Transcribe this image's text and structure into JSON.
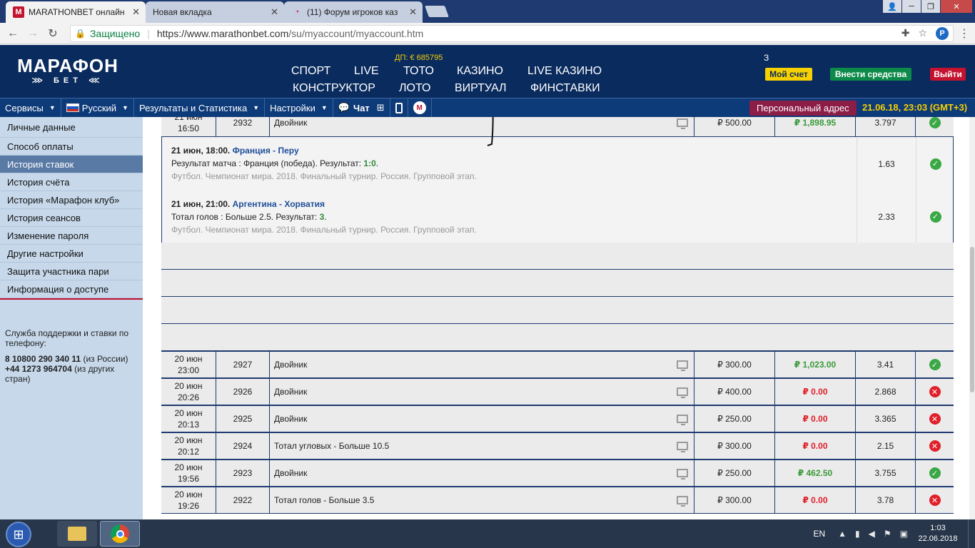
{
  "browser": {
    "tabs": [
      {
        "title": "MARATHONBET онлайн",
        "favicon": "marathon-favicon",
        "active": true
      },
      {
        "title": "Новая вкладка",
        "favicon": "blank",
        "active": false
      },
      {
        "title": "(11) Форум игроков каз",
        "favicon": "chat-favicon",
        "active": false
      }
    ],
    "secure_label": "Защищено",
    "url_host": "https://www.marathonbet.com",
    "url_path": "/su/myaccount/myaccount.htm"
  },
  "header": {
    "logo_main": "МАРАФОН",
    "logo_sub": "БЕТ",
    "jackpot": "ДП: € 685795",
    "nav": {
      "sport": "СПОРТ",
      "live": "LIVE",
      "toto": "ТОТО",
      "casino": "КАЗИНО",
      "live_casino": "LIVE КАЗИНО",
      "constructor": "КОНСТРУКТОР",
      "loto": "ЛОТО",
      "virtual": "ВИРТУАЛ",
      "finstavki": "ФИНСТАВКИ"
    },
    "account_name": "З",
    "my_account": "Мой счет",
    "deposit": "Внести средства",
    "logout": "Выйти"
  },
  "subnav": {
    "services": "Сервисы",
    "language": "Русский",
    "results": "Результаты и Статистика",
    "settings": "Настройки",
    "chat": "Чат",
    "personal_address": "Персональный адрес",
    "datetime": "21.06.18, 23:03 (GMT+3)"
  },
  "sidebar": {
    "items": [
      {
        "label": "Личные данные",
        "active": false
      },
      {
        "label": "Способ оплаты",
        "active": false
      },
      {
        "label": "История ставок",
        "active": true
      },
      {
        "label": "История счёта",
        "active": false
      },
      {
        "label": "История «Марафон клуб»",
        "active": false
      },
      {
        "label": "История сеансов",
        "active": false
      },
      {
        "label": "Изменение пароля",
        "active": false
      },
      {
        "label": "Другие настройки",
        "active": false
      },
      {
        "label": "Защита участника пари",
        "active": false
      },
      {
        "label": "Информация о доступе",
        "active": false
      }
    ],
    "support_title": "Служба поддержки и ставки по телефону:",
    "phone_ru": "8 10800 290 340 11",
    "phone_ru_note": "(из России)",
    "phone_intl": "+44 1273 964704",
    "phone_intl_note": "(из других стран)"
  },
  "bets": {
    "top_row": {
      "date": "21 июн",
      "time": "16:50",
      "id": "2932",
      "type": "Двойник",
      "stake": "₽ 500.00",
      "payout": "₽ 1,898.95",
      "odds": "3.797",
      "status": "win"
    },
    "details": [
      {
        "datetime": "21 июн, 18:00.",
        "teams": "Франция - Перу",
        "market": "Результат матча : Франция (победа). Результат:",
        "result": "1:0",
        "league": "Футбол. Чемпионат мира. 2018. Финальный турнир. Россия. Групповой этап.",
        "odds": "1.63",
        "status": "win"
      },
      {
        "datetime": "21 июн, 21:00.",
        "teams": "Аргентина - Хорватия",
        "market": "Тотал голов : Больше 2.5. Результат:",
        "result": "3",
        "league": "Футбол. Чемпионат мира. 2018. Финальный турнир. Россия. Групповой этап.",
        "odds": "2.33",
        "status": "win"
      }
    ],
    "rows": [
      {
        "date": "20 июн",
        "time": "23:00",
        "id": "2927",
        "type": "Двойник",
        "stake": "₽ 300.00",
        "payout": "₽ 1,023.00",
        "odds": "3.41",
        "status": "win"
      },
      {
        "date": "20 июн",
        "time": "20:26",
        "id": "2926",
        "type": "Двойник",
        "stake": "₽ 400.00",
        "payout": "₽ 0.00",
        "odds": "2.868",
        "status": "loss"
      },
      {
        "date": "20 июн",
        "time": "20:13",
        "id": "2925",
        "type": "Двойник",
        "stake": "₽ 250.00",
        "payout": "₽ 0.00",
        "odds": "3.365",
        "status": "loss"
      },
      {
        "date": "20 июн",
        "time": "20:12",
        "id": "2924",
        "type": "Тотал угловых - Больше 10.5",
        "stake": "₽ 300.00",
        "payout": "₽ 0.00",
        "odds": "2.15",
        "status": "loss"
      },
      {
        "date": "20 июн",
        "time": "19:56",
        "id": "2923",
        "type": "Двойник",
        "stake": "₽ 250.00",
        "payout": "₽ 462.50",
        "odds": "3.755",
        "status": "win"
      },
      {
        "date": "20 июн",
        "time": "19:26",
        "id": "2922",
        "type": "Тотал голов - Больше 3.5",
        "stake": "₽ 300.00",
        "payout": "₽ 0.00",
        "odds": "3.78",
        "status": "loss"
      }
    ]
  },
  "taskbar": {
    "lang": "EN",
    "time": "1:03",
    "date": "22.06.2018"
  },
  "colors": {
    "header_bg": "#0a2b5e",
    "subnav_bg": "#0d3a78",
    "accent_yellow": "#f7d000",
    "win_green": "#3a9a3a",
    "loss_red": "#e0202a"
  }
}
